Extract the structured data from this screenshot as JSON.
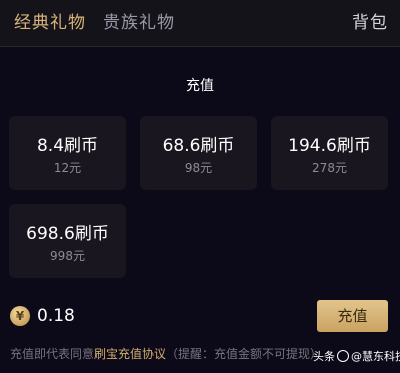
{
  "tabs": {
    "classic": "经典礼物",
    "noble": "贵族礼物",
    "backpack": "背包"
  },
  "panel": {
    "title": "充值"
  },
  "packages": [
    {
      "amount": "8.4刷币",
      "price": "12元"
    },
    {
      "amount": "68.6刷币",
      "price": "98元"
    },
    {
      "amount": "194.6刷币",
      "price": "278元"
    },
    {
      "amount": "698.6刷币",
      "price": "998元"
    }
  ],
  "balance": {
    "coin_symbol": "¥",
    "value": "0.18"
  },
  "recharge_button": "充值",
  "footer": {
    "prefix": "充值即代表同意",
    "link": "刷宝充值协议",
    "suffix": "（提醒：充值金额不可提现）"
  },
  "watermark": {
    "label": "头条",
    "account": "@慧东科技"
  },
  "colors": {
    "accent_gold": "#d9b47a",
    "background": "#0c0918",
    "card": "#19161f"
  }
}
